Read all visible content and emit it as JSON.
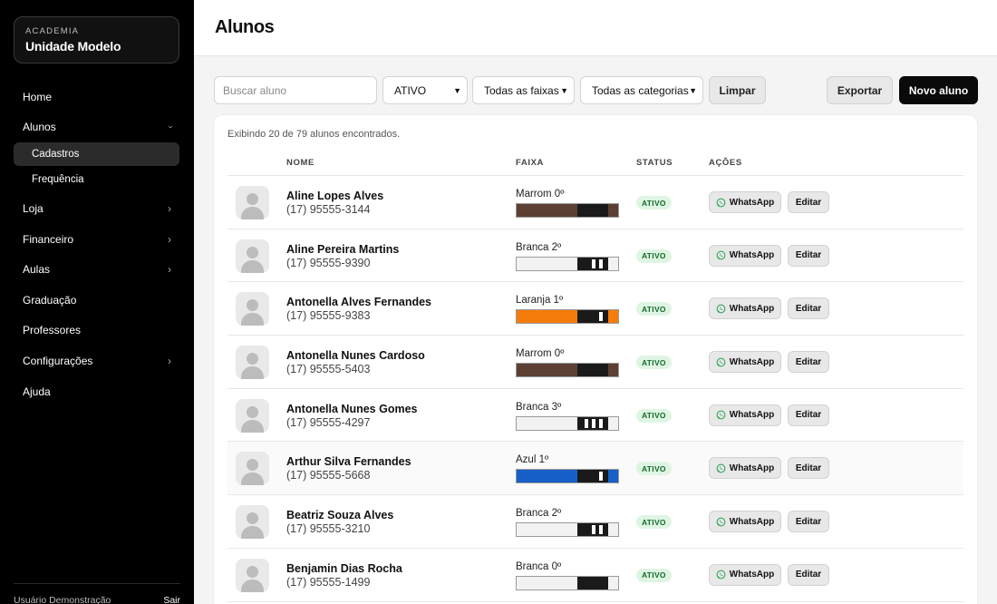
{
  "brand": {
    "kicker": "ACADEMIA",
    "name": "Unidade Modelo"
  },
  "nav": {
    "home": "Home",
    "alunos": "Alunos",
    "sub_cadastros": "Cadastros",
    "sub_frequencia": "Frequência",
    "loja": "Loja",
    "financeiro": "Financeiro",
    "aulas": "Aulas",
    "graduacao": "Graduação",
    "professores": "Professores",
    "configuracoes": "Configurações",
    "ajuda": "Ajuda"
  },
  "footer": {
    "user": "Usuário Demonstração",
    "logout": "Sair"
  },
  "header": {
    "title": "Alunos"
  },
  "toolbar": {
    "search_placeholder": "Buscar aluno",
    "status_selected": "ATIVO",
    "belt_selected": "Todas as faixas",
    "category_selected": "Todas as categorias",
    "clear": "Limpar",
    "export": "Exportar",
    "new": "Novo aluno"
  },
  "list": {
    "count_text": "Exibindo 20 de 79 alunos encontrados.",
    "columns": {
      "name": "NOME",
      "belt": "FAIXA",
      "status": "STATUS",
      "actions": "AÇÕES"
    },
    "whatsapp_label": "WhatsApp",
    "edit_label": "Editar",
    "rows": [
      {
        "name": "Aline Lopes Alves",
        "phone": "(17) 95555-3144",
        "belt": "Marrom 0º",
        "belt_color": "#5c4033",
        "stripes": 0,
        "status": "ATIVO"
      },
      {
        "name": "Aline Pereira Martins",
        "phone": "(17) 95555-9390",
        "belt": "Branca 2º",
        "belt_color": "#f2f2f2",
        "stripes": 2,
        "status": "ATIVO"
      },
      {
        "name": "Antonella Alves Fernandes",
        "phone": "(17) 95555-9383",
        "belt": "Laranja 1º",
        "belt_color": "#f57c0a",
        "stripes": 1,
        "status": "ATIVO"
      },
      {
        "name": "Antonella Nunes Cardoso",
        "phone": "(17) 95555-5403",
        "belt": "Marrom 0º",
        "belt_color": "#5c4033",
        "stripes": 0,
        "status": "ATIVO"
      },
      {
        "name": "Antonella Nunes Gomes",
        "phone": "(17) 95555-4297",
        "belt": "Branca 3º",
        "belt_color": "#f2f2f2",
        "stripes": 3,
        "status": "ATIVO"
      },
      {
        "name": "Arthur Silva Fernandes",
        "phone": "(17) 95555-5668",
        "belt": "Azul 1º",
        "belt_color": "#1660c8",
        "stripes": 1,
        "status": "ATIVO"
      },
      {
        "name": "Beatriz Souza Alves",
        "phone": "(17) 95555-3210",
        "belt": "Branca 2º",
        "belt_color": "#f2f2f2",
        "stripes": 2,
        "status": "ATIVO"
      },
      {
        "name": "Benjamin Dias Rocha",
        "phone": "(17) 95555-1499",
        "belt": "Branca 0º",
        "belt_color": "#f2f2f2",
        "stripes": 0,
        "status": "ATIVO"
      }
    ]
  }
}
